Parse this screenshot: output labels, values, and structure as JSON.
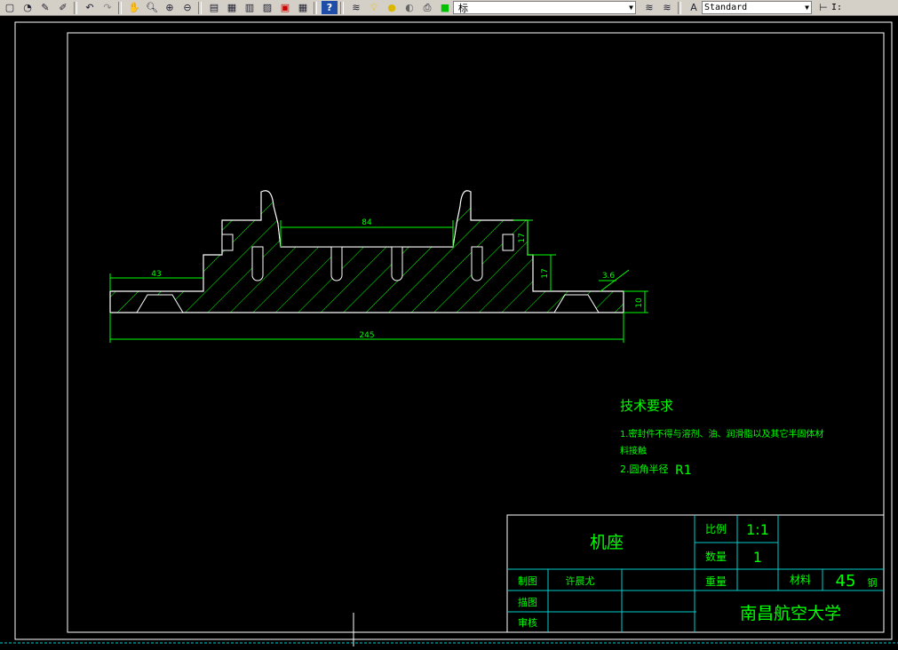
{
  "toolbar": {
    "layer_name": "标",
    "text_style": "Standard",
    "trailing_label": "I:"
  },
  "drawing": {
    "dims": {
      "width_top": "84",
      "height_right_upper": "17",
      "height_right_lower": "17",
      "width_left": "43",
      "chamfer": "3.6",
      "height_base": "10",
      "overall": "245"
    },
    "tech": {
      "heading": "技术要求",
      "line1": "1.密封件不得与溶剂、油、润滑脂以及其它半固体材",
      "line1b": "料接触",
      "line2_prefix": "2.圆角半径",
      "line2_value": "R1"
    },
    "title_block": {
      "part_name": "机座",
      "scale_label": "比例",
      "scale_value": "1:1",
      "qty_label": "数量",
      "qty_value": "1",
      "weight_label": "重量",
      "material_label": "材料",
      "material_value": "45",
      "material_suffix": "钢",
      "drawn_label": "制图",
      "drawn_name": "许晨尤",
      "traced_label": "描图",
      "checked_label": "审核",
      "institution": "南昌航空大学"
    }
  }
}
